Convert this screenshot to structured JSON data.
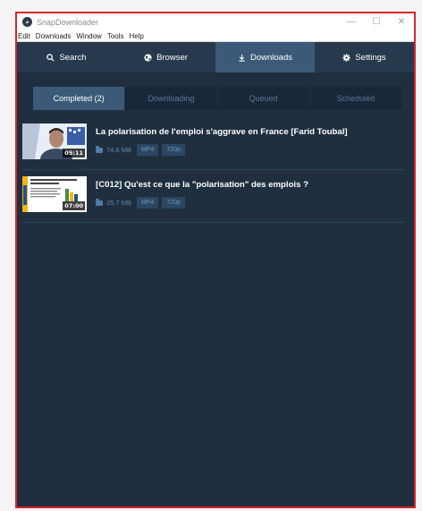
{
  "window": {
    "title": "SnapDownloader"
  },
  "menu": [
    "Edit",
    "Downloads",
    "Window",
    "Tools",
    "Help"
  ],
  "nav": {
    "search": "Search",
    "browser": "Browser",
    "downloads": "Downloads",
    "settings": "Settings",
    "active": "downloads"
  },
  "subtabs": {
    "completed": "Completed (2)",
    "downloading": "Downloading",
    "queued": "Queued",
    "scheduled": "Scheduled"
  },
  "downloads": [
    {
      "title": "La polarisation de l'emploi s'aggrave en France [Farid Toubal]",
      "duration": "05:11",
      "size": "74.8 MB",
      "format": "MP4",
      "quality": "720p"
    },
    {
      "title": "[C012] Qu'est ce que la \"polarisation\" des emplois ?",
      "duration": "07:00",
      "size": "25.7 MB",
      "format": "MP4",
      "quality": "720p"
    }
  ],
  "colors": {
    "accent": "#3c5a78",
    "background": "#1f2f3f",
    "nav": "#273a4d",
    "frame": "#d7262f"
  }
}
